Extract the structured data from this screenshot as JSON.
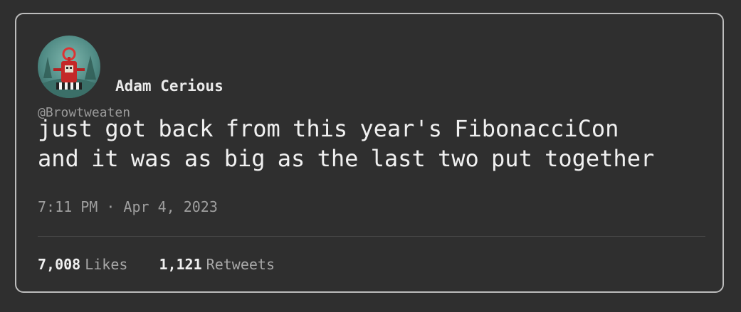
{
  "tweet": {
    "display_name": "Adam Cerious",
    "handle": "@Browtweaten",
    "text": "just got back from this year's FibonacciCon\nand it was as big as the last two put together",
    "timestamp": "7:11 PM · Apr 4, 2023",
    "likes_count": "7,008",
    "likes_label": "Likes",
    "retweets_count": "1,121",
    "retweets_label": "Retweets"
  },
  "colors": {
    "background": "#2f2f2f",
    "card_border": "#bdbdbd",
    "text_primary": "#f0f0f0",
    "text_secondary": "#9e9e9e"
  },
  "icons": {
    "avatar": "robot-avatar-image"
  }
}
